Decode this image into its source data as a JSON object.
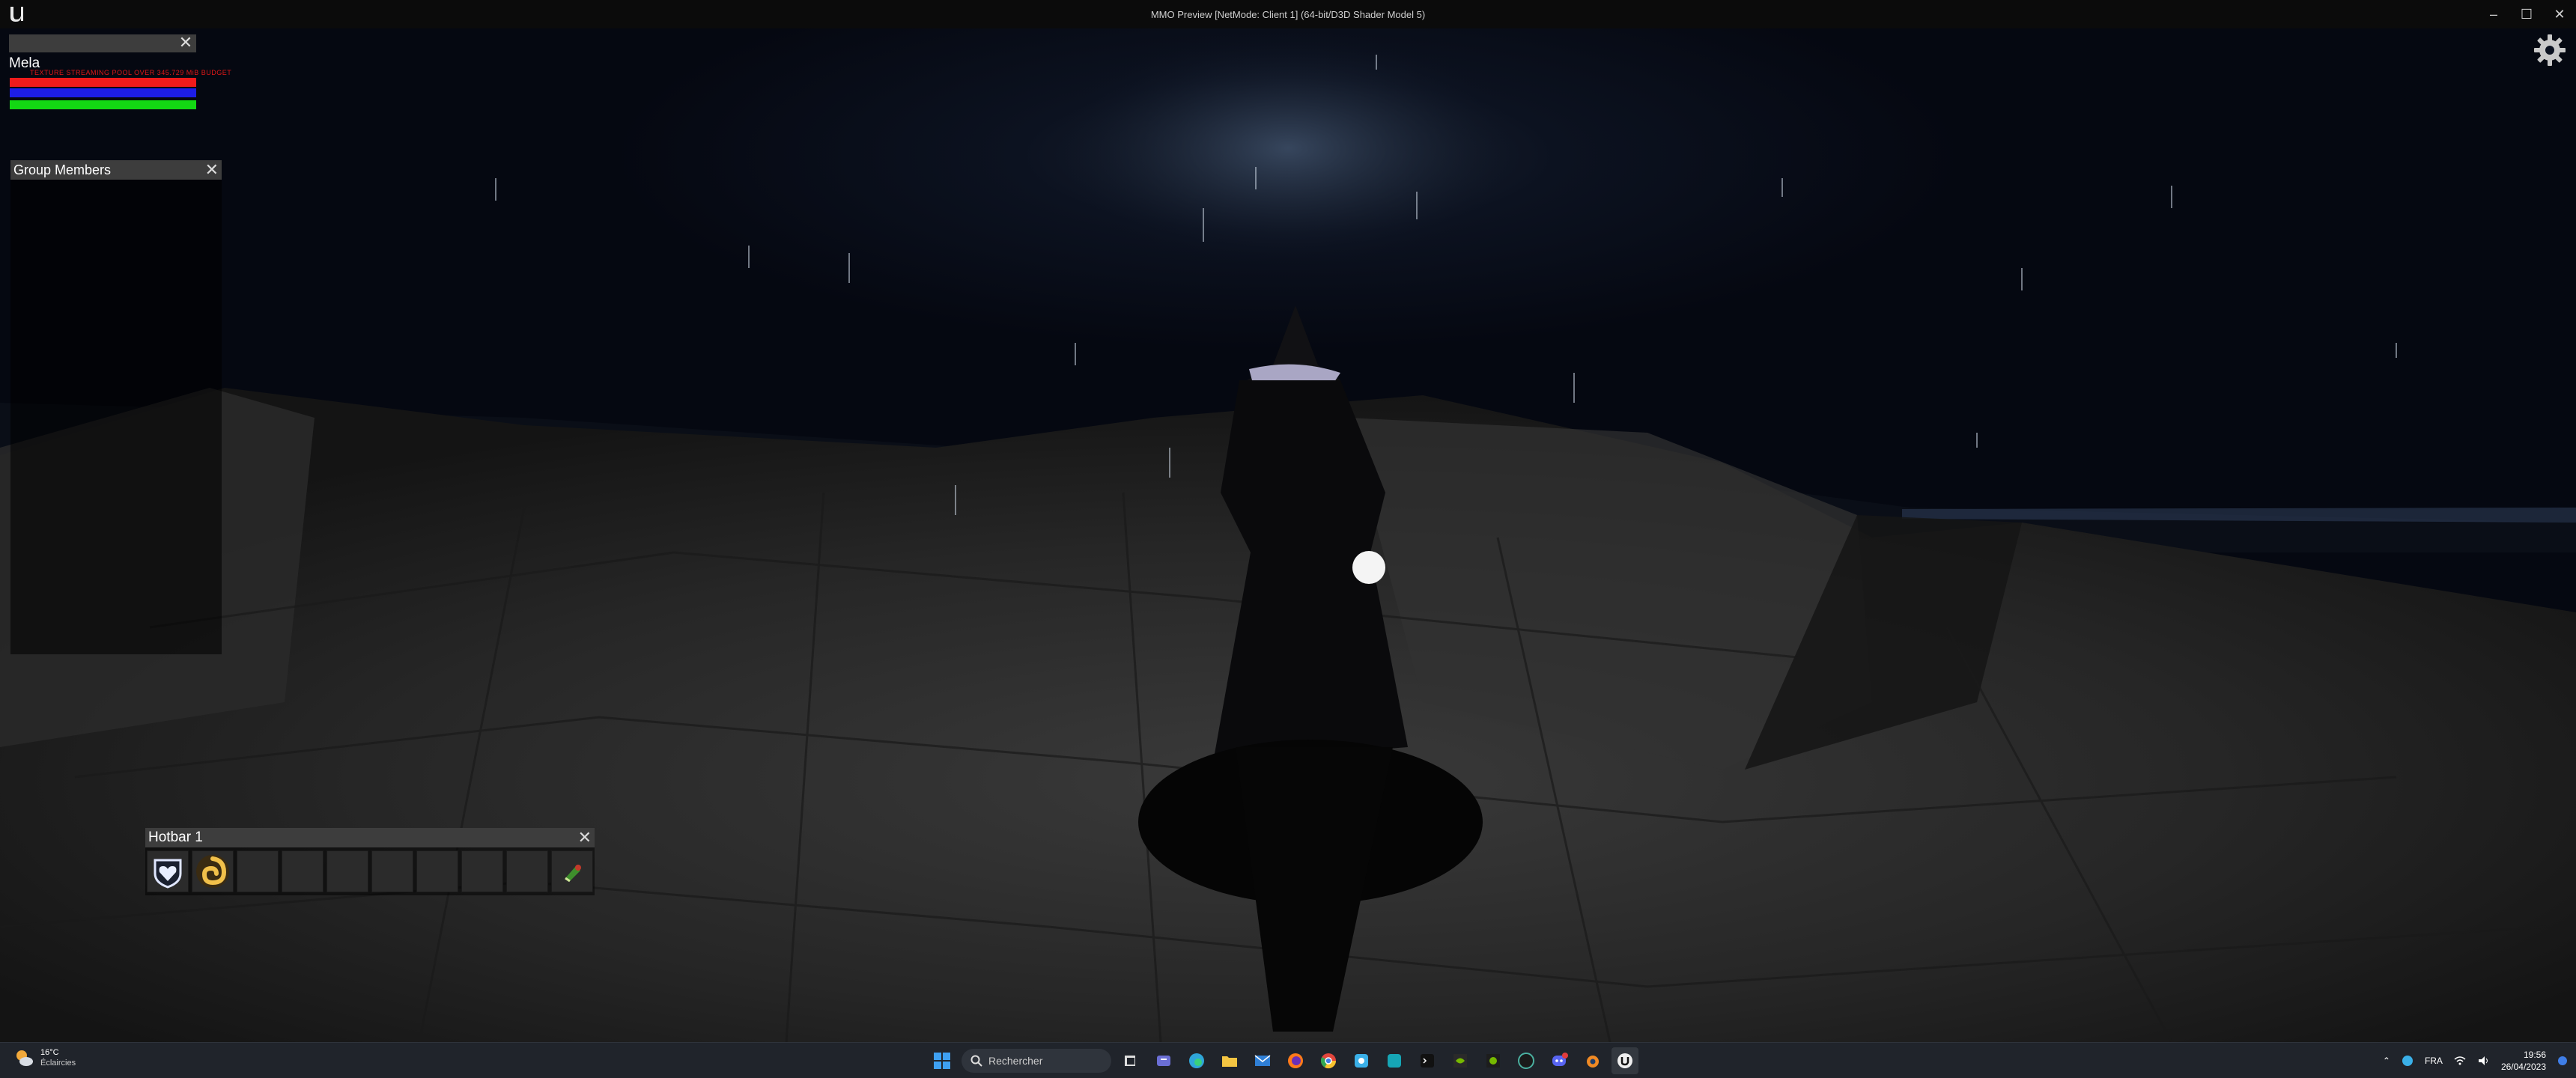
{
  "window": {
    "title": "MMO Preview [NetMode: Client 1]  (64-bit/D3D Shader Model 5)",
    "controls": [
      "–",
      "☐",
      "✕"
    ]
  },
  "hud": {
    "player_name": "Mela",
    "warning_text": "TEXTURE STREAMING POOL OVER 345.729 MiB BUDGET",
    "bar_colors": {
      "health": "#ef1b1b",
      "mana": "#1d1de6",
      "stamina": "#13d813"
    }
  },
  "group_panel": {
    "title": "Group Members"
  },
  "hotbar": {
    "title": "Hotbar 1",
    "slots": [
      {
        "icon": "heart-shield-icon"
      },
      {
        "icon": "golden-swirl-icon"
      },
      {
        "icon": ""
      },
      {
        "icon": ""
      },
      {
        "icon": ""
      },
      {
        "icon": ""
      },
      {
        "icon": ""
      },
      {
        "icon": ""
      },
      {
        "icon": ""
      },
      {
        "icon": "green-potion-icon"
      }
    ]
  },
  "taskbar": {
    "weather_temp": "16°C",
    "weather_desc": "Éclaircies",
    "search_placeholder": "Rechercher",
    "language": "FRA",
    "time": "19:56",
    "date": "26/04/2023"
  }
}
